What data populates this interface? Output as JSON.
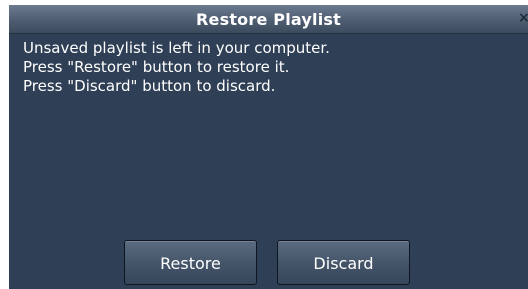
{
  "dialog": {
    "title": "Restore Playlist",
    "close_glyph": "×",
    "message_lines": [
      "Unsaved playlist is left in your computer.",
      "Press \"Restore\" button to restore it.",
      "Press \"Discard\" button to discard."
    ],
    "buttons": {
      "restore_label": "Restore",
      "discard_label": "Discard"
    }
  },
  "icons": {
    "close": "close-icon"
  },
  "colors": {
    "dialog_background": "#2f3f55",
    "title_bar": "#4e5d71",
    "text": "#ffffff"
  }
}
